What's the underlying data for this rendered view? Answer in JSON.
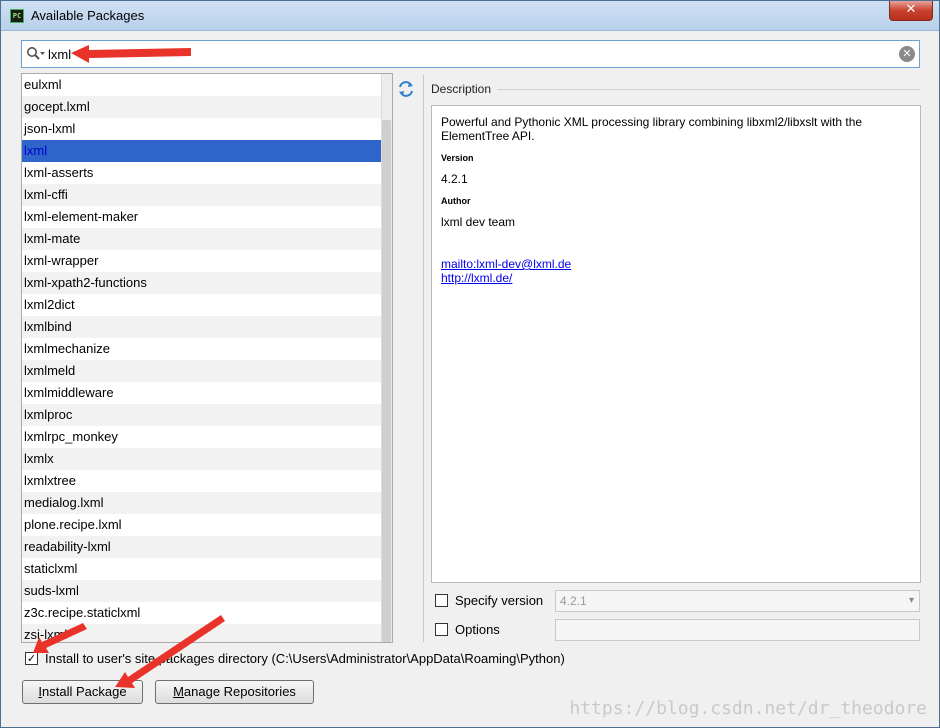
{
  "window": {
    "title": "Available Packages",
    "close_label": "✕"
  },
  "search": {
    "value": "lxml",
    "clear_label": "✕"
  },
  "packages": [
    "eulxml",
    "gocept.lxml",
    "json-lxml",
    "lxml",
    "lxml-asserts",
    "lxml-cffi",
    "lxml-element-maker",
    "lxml-mate",
    "lxml-wrapper",
    "lxml-xpath2-functions",
    "lxml2dict",
    "lxmlbind",
    "lxmlmechanize",
    "lxmlmeld",
    "lxmlmiddleware",
    "lxmlproc",
    "lxmlrpc_monkey",
    "lxmlx",
    "lxmlxtree",
    "medialog.lxml",
    "plone.recipe.lxml",
    "readability-lxml",
    "staticlxml",
    "suds-lxml",
    "z3c.recipe.staticlxml",
    "zsi-lxml"
  ],
  "selected_package": "lxml",
  "description": {
    "label": "Description",
    "summary": "Powerful and Pythonic XML processing library combining libxml2/libxslt with the ElementTree API.",
    "version_heading": "Version",
    "version": "4.2.1",
    "author_heading": "Author",
    "author": "lxml dev team",
    "email_link": "mailto:lxml-dev@lxml.de",
    "homepage_link": "http://lxml.de/"
  },
  "options": {
    "specify_version_label": "Specify version",
    "specify_version_checked": false,
    "version_select_value": "4.2.1",
    "options_label": "Options",
    "options_checked": false,
    "install_user_site_label": "Install to user's site packages directory (C:\\Users\\Administrator\\AppData\\Roaming\\Python)",
    "install_user_site_checked": true
  },
  "buttons": {
    "install_prefix": "I",
    "install_rest": "nstall Package",
    "manage_prefix": "M",
    "manage_rest": "anage Repositories"
  },
  "watermark": "https://blog.csdn.net/dr_theodore",
  "colors": {
    "selection": "#2f65ca",
    "annotation_arrow": "#e8322a",
    "link": "#0000ee"
  },
  "icons": {
    "search": "search-dropdown-icon",
    "refresh": "refresh-icon",
    "app": "pycharm-icon"
  }
}
